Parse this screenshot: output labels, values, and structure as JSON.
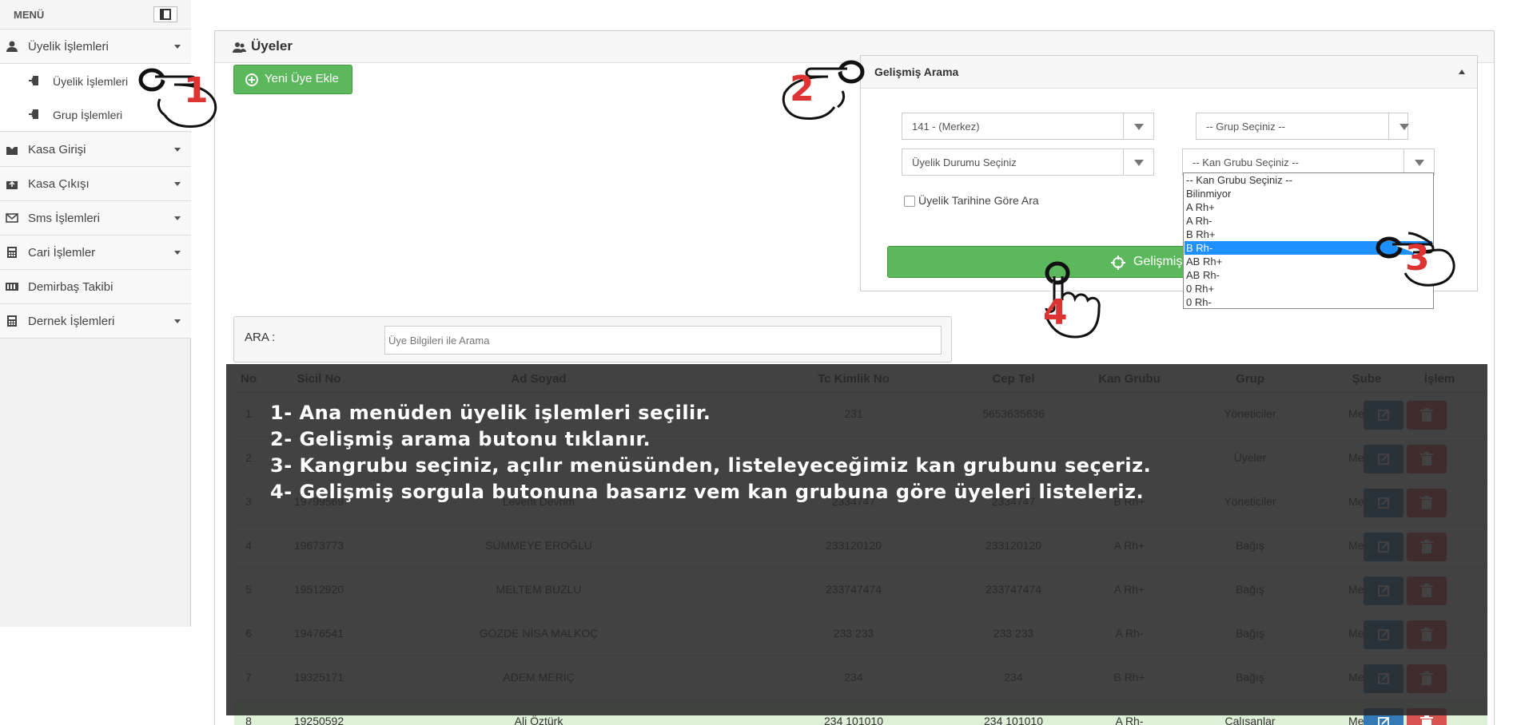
{
  "sidebar": {
    "menu_title": "MENÜ",
    "items": [
      {
        "label": "Üyelik İşlemleri",
        "icon": "user-icon"
      },
      {
        "label": "Kasa Girişi",
        "icon": "cash-in-icon"
      },
      {
        "label": "Kasa Çıkışı",
        "icon": "cash-out-icon"
      },
      {
        "label": "Sms İşlemleri",
        "icon": "envelope-icon"
      },
      {
        "label": "Cari İşlemler",
        "icon": "calculator-icon"
      },
      {
        "label": "Demirbaş Takibi",
        "icon": "inventory-icon"
      },
      {
        "label": "Dernek İşlemleri",
        "icon": "calculator-icon"
      }
    ],
    "subitems": [
      {
        "label": "Üyelik İşlemleri",
        "icon": "sign-in-icon"
      },
      {
        "label": "Grup İşlemleri",
        "icon": "sign-in-icon"
      }
    ]
  },
  "main": {
    "title": "Üyeler",
    "add_button": "Yeni Üye Ekle"
  },
  "advanced_search": {
    "title": "Gelişmiş Arama",
    "branch_select": "141 - (Merkez)",
    "group_select": "-- Grup Seçiniz --",
    "membership_status_select": "Üyelik Durumu Seçiniz",
    "blood_group_select": "-- Kan Grubu Seçiniz --",
    "date_checkbox_label": "Üyelik Tarihine Göre Ara",
    "search_button": "Gelişmiş",
    "blood_options": [
      "-- Kan Grubu Seçiniz --",
      "Bilinmiyor",
      "A Rh+",
      "A Rh-",
      "B Rh+",
      "B Rh-",
      "AB Rh+",
      "AB Rh-",
      "0 Rh+",
      "0 Rh-"
    ],
    "highlighted_option": "B Rh-"
  },
  "search": {
    "label": "ARA :",
    "placeholder": "Üye Bilgileri ile Arama"
  },
  "table": {
    "headers": [
      "No",
      "Sicil No",
      "Ad Soyad",
      "Tc Kimlik No",
      "Cep Tel",
      "Kan Grubu",
      "Grup",
      "Şube",
      "İşlem"
    ],
    "rows": [
      [
        "1",
        "",
        "",
        "231",
        "5653635636",
        "",
        "Yöneticiler",
        "Merkez"
      ],
      [
        "2",
        "",
        "",
        "",
        "",
        "",
        "Üyeler",
        "Merkez"
      ],
      [
        "3",
        "19799569",
        "Levent Devrim",
        "2334747",
        "2334747",
        "B Rh+",
        "Yöneticiler",
        "Merkez"
      ],
      [
        "4",
        "19673773",
        "SÜMMEYE EROĞLU",
        "233120120",
        "233120120",
        "A Rh+",
        "Bağış",
        "Merkez"
      ],
      [
        "5",
        "19512920",
        "MELTEM BUZLU",
        "233747474",
        "233747474",
        "A Rh+",
        "Bağış",
        "Merkez"
      ],
      [
        "6",
        "19476541",
        "GÖZDE NİSA MALKOÇ",
        "233 233",
        "233 233",
        "A Rh-",
        "Bağış",
        "Merkez"
      ],
      [
        "7",
        "19325171",
        "ADEM MERİÇ",
        "234",
        "234",
        "B Rh+",
        "Bağış",
        "Merkez"
      ],
      [
        "8",
        "19250592",
        "Ali Öztürk",
        "234 101010",
        "234 101010",
        "A Rh-",
        "Çalışanlar",
        "Merkez"
      ]
    ]
  },
  "instructions": [
    "1- Ana menüden üyelik işlemleri seçilir.",
    "2- Gelişmiş arama butonu tıklanır.",
    "3- Kangrubu  seçiniz, açılır menüsünden, listeleyeceğimiz  kan grubunu seçeriz.",
    "4- Gelişmiş sorgula butonuna basarız vem kan grubuna göre üyeleri listeleriz."
  ],
  "step_badges": [
    "1",
    "2",
    "3",
    "4"
  ],
  "colors": {
    "accent_green": "#5cb85c",
    "edit_blue": "#337ab7",
    "delete_red": "#d9534f",
    "badge_red": "#dd3333",
    "highlight": "#1e90ff"
  }
}
